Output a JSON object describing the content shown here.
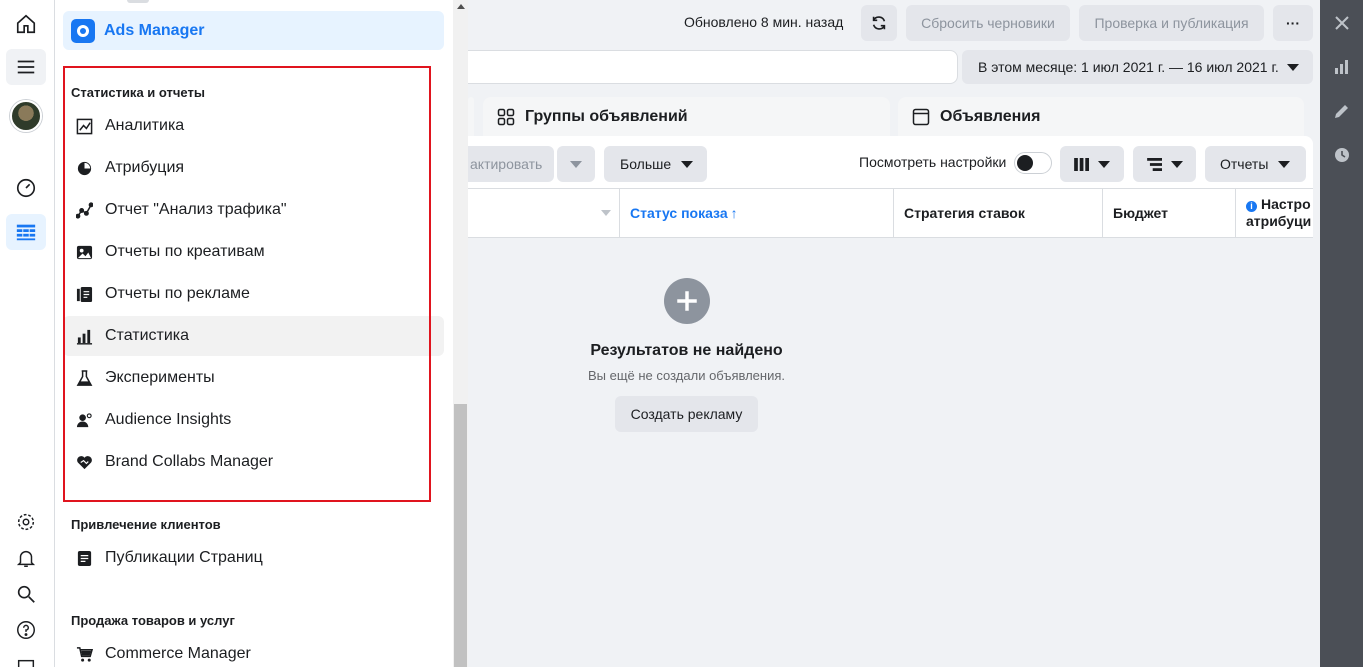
{
  "menu": {
    "title": "Ads Manager",
    "sections": [
      {
        "title": "Статистика и отчеты",
        "items": [
          {
            "label": "Аналитика",
            "icon": "analytics-icon"
          },
          {
            "label": "Атрибуция",
            "icon": "attribution-icon"
          },
          {
            "label": "Отчет \"Анализ трафика\"",
            "icon": "traffic-analysis-icon"
          },
          {
            "label": "Отчеты по креативам",
            "icon": "creative-reports-icon"
          },
          {
            "label": "Отчеты по рекламе",
            "icon": "ads-reports-icon"
          },
          {
            "label": "Статистика",
            "icon": "statistics-icon"
          },
          {
            "label": "Эксперименты",
            "icon": "experiments-icon"
          },
          {
            "label": "Audience Insights",
            "icon": "audience-insights-icon"
          },
          {
            "label": "Brand Collabs Manager",
            "icon": "brand-collabs-icon"
          }
        ]
      },
      {
        "title": "Привлечение клиентов",
        "items": [
          {
            "label": "Публикации Страниц",
            "icon": "page-posts-icon"
          }
        ]
      },
      {
        "title": "Продажа товаров и услуг",
        "items": [
          {
            "label": "Commerce Manager",
            "icon": "cart-icon"
          }
        ]
      }
    ]
  },
  "header": {
    "updated": "Обновлено 8 мин. назад",
    "reset_drafts": "Сбросить черновики",
    "review_publish": "Проверка и публикация",
    "more": "···",
    "date_range": "В этом месяце: 1 июл 2021 г. — 16 июл 2021 г."
  },
  "tabs": {
    "adsets": "Группы объявлений",
    "ads": "Объявления"
  },
  "toolbar": {
    "edit_partial": "актировать",
    "more": "Больше",
    "view_settings": "Посмотреть настройки",
    "reports": "Отчеты"
  },
  "table": {
    "columns": [
      "Статус показа",
      "Стратегия ставок",
      "Бюджет",
      "Настро атрибуци"
    ],
    "attribution_line1": "Настро",
    "attribution_line2": "атрибуци"
  },
  "empty": {
    "title": "Результатов не найдено",
    "subtitle": "Вы ещё не создали объявления.",
    "button": "Создать рекламу"
  },
  "colors": {
    "accent": "#1877f2",
    "highlight_border": "#e0141e"
  }
}
